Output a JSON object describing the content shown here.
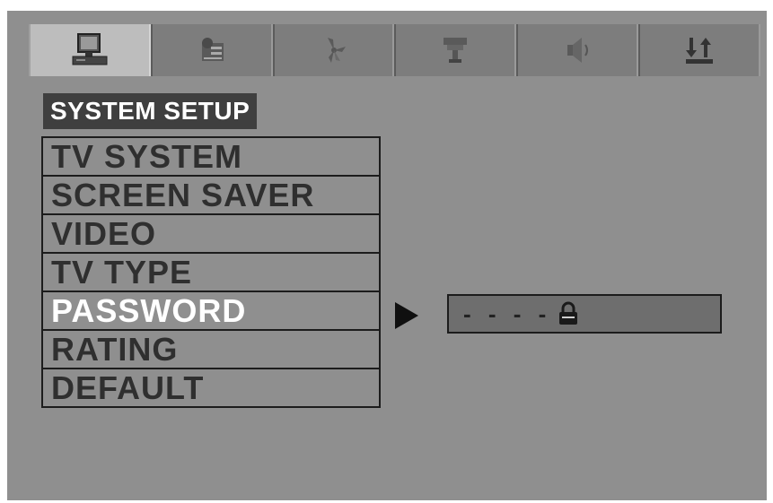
{
  "tabs": [
    {
      "icon": "monitor-icon",
      "active": true
    },
    {
      "icon": "language-icon",
      "active": false
    },
    {
      "icon": "fan-icon",
      "active": false
    },
    {
      "icon": "speaker-stand-icon",
      "active": false
    },
    {
      "icon": "audio-speaker-icon",
      "active": false
    },
    {
      "icon": "sort-arrows-icon",
      "active": false
    }
  ],
  "section_title": "SYSTEM SETUP",
  "menu": {
    "items": [
      {
        "label": "TV SYSTEM"
      },
      {
        "label": "SCREEN SAVER"
      },
      {
        "label": "VIDEO"
      },
      {
        "label": "TV TYPE"
      },
      {
        "label": "PASSWORD"
      },
      {
        "label": "RATING"
      },
      {
        "label": "DEFAULT"
      }
    ],
    "selected_index": 4
  },
  "password": {
    "value": "- - - -",
    "icon": "lock-icon"
  },
  "colors": {
    "background": "#8f8f8f",
    "tab_active": "#bdbdbd",
    "title_bg": "#3f3f3f",
    "selected_text": "#ffffff"
  }
}
